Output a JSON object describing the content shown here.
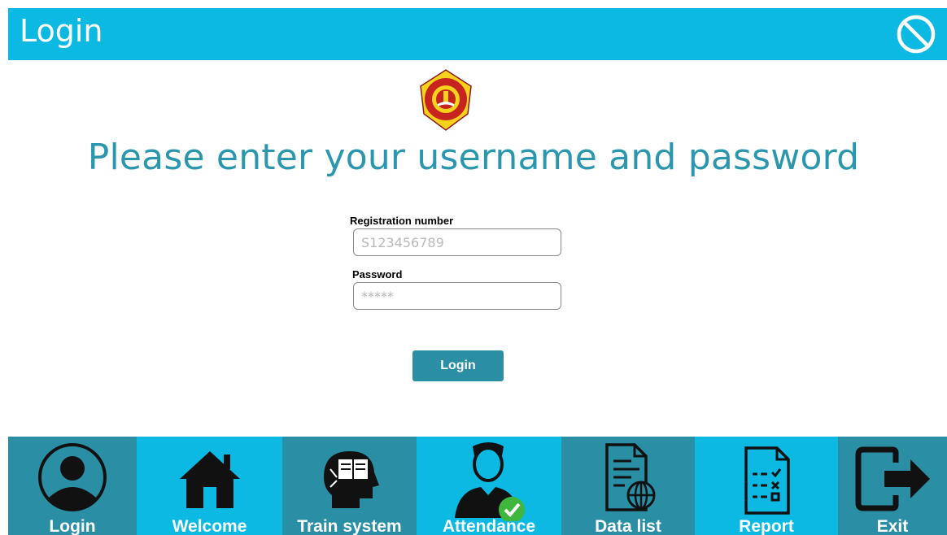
{
  "window": {
    "title": "Login"
  },
  "main": {
    "headline": "Please enter your username and password",
    "registration": {
      "label": "Registration number",
      "placeholder": "S123456789"
    },
    "password": {
      "label": "Password",
      "placeholder": "*****"
    },
    "login_button": "Login"
  },
  "nav": {
    "items": [
      {
        "label": "Login",
        "icon": "user-circle-icon",
        "color": "#2a8ea5"
      },
      {
        "label": "Welcome",
        "icon": "home-icon",
        "color": "#0cb9e2"
      },
      {
        "label": "Train system",
        "icon": "head-book-icon",
        "color": "#2a8ea5"
      },
      {
        "label": "Attendance",
        "icon": "person-check-icon",
        "color": "#0cb9e2"
      },
      {
        "label": "Data list",
        "icon": "document-globe-icon",
        "color": "#2a8ea5"
      },
      {
        "label": "Report",
        "icon": "checklist-icon",
        "color": "#0cb9e2"
      },
      {
        "label": "Exit",
        "icon": "exit-icon",
        "color": "#2a8ea5"
      }
    ]
  },
  "colors": {
    "header": "#0cb9e2",
    "accent": "#2a97ae",
    "button": "#2a8ea5"
  }
}
